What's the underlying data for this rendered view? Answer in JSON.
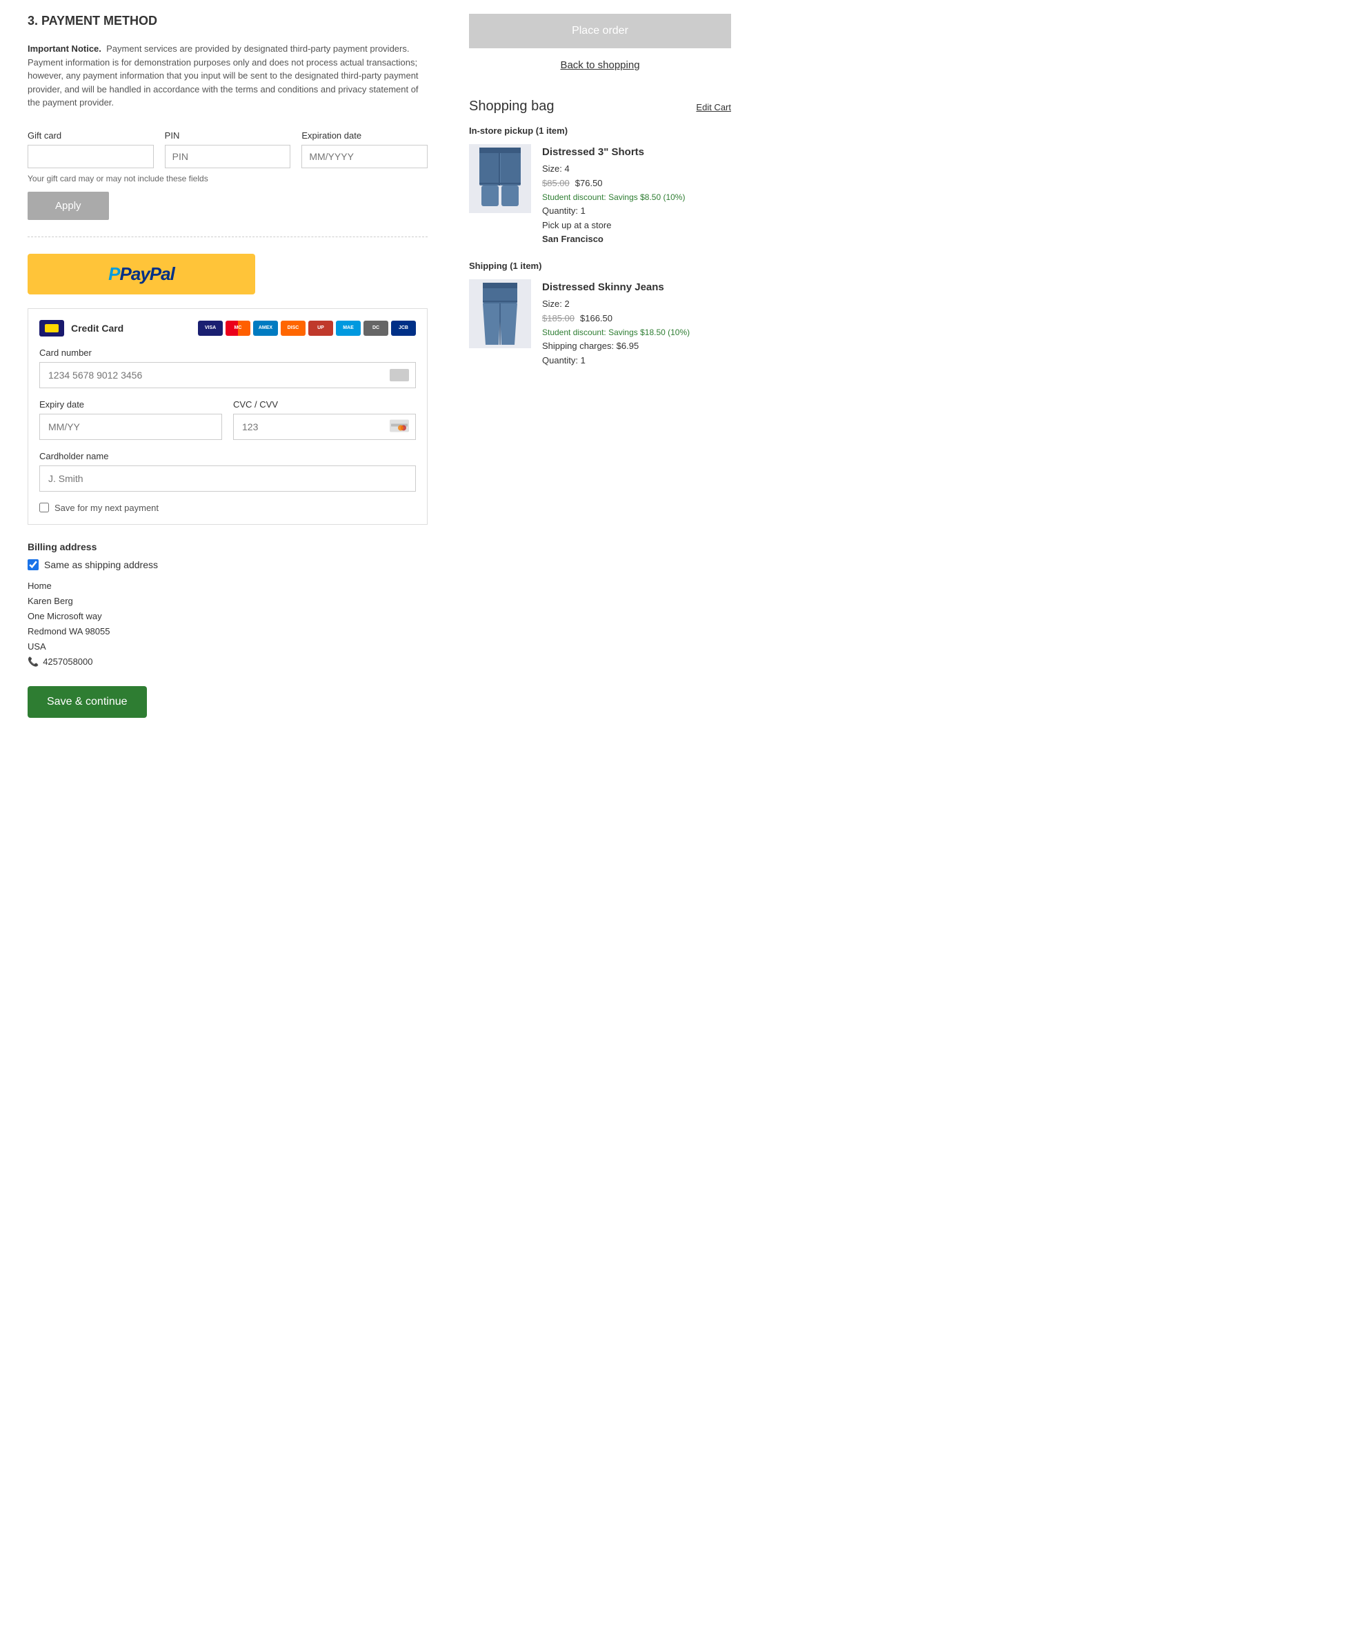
{
  "page": {
    "section_title": "3. PAYMENT METHOD",
    "important_notice_label": "Important Notice.",
    "important_notice_text": "Payment services are provided by designated third-party payment providers. Payment information is for demonstration purposes only and does not process actual transactions; however, any payment information that you input will be sent to the designated third-party payment provider, and will be handled in accordance with the terms and conditions and privacy statement of the payment provider."
  },
  "gift_card": {
    "label": "Gift card",
    "pin_label": "PIN",
    "pin_placeholder": "PIN",
    "expiry_label": "Expiration date",
    "expiry_placeholder": "MM/YYYY",
    "hint": "Your gift card may or may not include these fields",
    "apply_label": "Apply"
  },
  "paypal": {
    "p_char": "P",
    "text": "PayPal"
  },
  "credit_card": {
    "label": "Credit Card",
    "card_number_label": "Card number",
    "card_number_placeholder": "1234 5678 9012 3456",
    "expiry_label": "Expiry date",
    "expiry_placeholder": "MM/YY",
    "cvc_label": "CVC / CVV",
    "cvc_placeholder": "123",
    "cardholder_label": "Cardholder name",
    "cardholder_placeholder": "J. Smith",
    "save_label": "Save for my next payment",
    "logos": [
      "VISA",
      "MC",
      "AMEX",
      "DISC",
      "UP",
      "MAEST",
      "DC",
      "JCB"
    ]
  },
  "billing": {
    "title": "Billing address",
    "same_address_label": "Same as shipping address",
    "address_type": "Home",
    "name": "Karen Berg",
    "street": "One Microsoft way",
    "city_state_zip": "Redmond WA  98055",
    "country": "USA",
    "phone": "4257058000"
  },
  "actions": {
    "save_continue": "Save & continue"
  },
  "right_panel": {
    "place_order": "Place order",
    "back_to_shopping": "Back to shopping",
    "shopping_bag_title": "Shopping bag",
    "edit_cart": "Edit Cart",
    "instore_section": "In-store pickup (1 item)",
    "shipping_section": "Shipping (1 item)",
    "item1": {
      "name": "Distressed 3\" Shorts",
      "size": "Size: 4",
      "price_original": "$85.00",
      "price_current": "$76.50",
      "discount": "Student discount: Savings $8.50 (10%)",
      "quantity": "Quantity: 1",
      "pickup_label": "Pick up at a store",
      "pickup_store": "San Francisco"
    },
    "item2": {
      "name": "Distressed Skinny Jeans",
      "size": "Size: 2",
      "price_original": "$185.00",
      "price_current": "$166.50",
      "discount": "Student discount: Savings $18.50 (10%)",
      "shipping_charges": "Shipping charges: $6.95",
      "quantity": "Quantity: 1"
    }
  }
}
